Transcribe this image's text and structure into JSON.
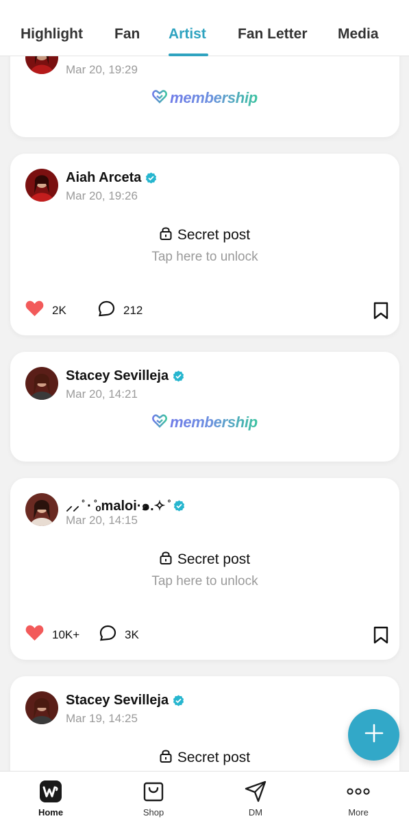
{
  "tabs": [
    {
      "label": "Highlight",
      "active": false
    },
    {
      "label": "Fan",
      "active": false
    },
    {
      "label": "Artist",
      "active": true
    },
    {
      "label": "Fan Letter",
      "active": false
    },
    {
      "label": "Media",
      "active": false
    }
  ],
  "posts": [
    {
      "author": "",
      "date": "Mar 20, 19:29",
      "type": "membership",
      "membership_label": "membership"
    },
    {
      "author": "Aiah Arceta",
      "date": "Mar 20, 19:26",
      "type": "secret",
      "secret_title": "Secret post",
      "secret_sub": "Tap here to unlock",
      "likes": "2K",
      "comments": "212"
    },
    {
      "author": "Stacey Sevilleja",
      "date": "Mar 20, 14:21",
      "type": "membership",
      "membership_label": "membership"
    },
    {
      "author": "⸝⸝ ̊ ·  ̊ₒmaloi·๑.✧ ̊",
      "date": "Mar 20, 14:15",
      "type": "secret",
      "secret_title": "Secret post",
      "secret_sub": "Tap here to unlock",
      "likes": "10K+",
      "comments": "3K"
    },
    {
      "author": "Stacey Sevilleja",
      "date": "Mar 19, 14:25",
      "type": "secret",
      "secret_title": "Secret post"
    }
  ],
  "bottom_nav": [
    {
      "label": "Home",
      "icon": "weverse-home-icon",
      "active": true
    },
    {
      "label": "Shop",
      "icon": "shopping-bag-icon",
      "active": false
    },
    {
      "label": "DM",
      "icon": "paper-plane-icon",
      "active": false
    },
    {
      "label": "More",
      "icon": "more-dots-icon",
      "active": false
    }
  ],
  "colors": {
    "accent": "#2fa3c0",
    "heart": "#f25a5a",
    "verified": "#27b6cf",
    "fab": "#32a8c8"
  },
  "icons": {
    "verified": "verified-badge-icon",
    "lock": "lock-icon",
    "like": "heart-icon",
    "comment": "comment-bubble-icon",
    "bookmark": "bookmark-icon",
    "add": "plus-icon"
  }
}
